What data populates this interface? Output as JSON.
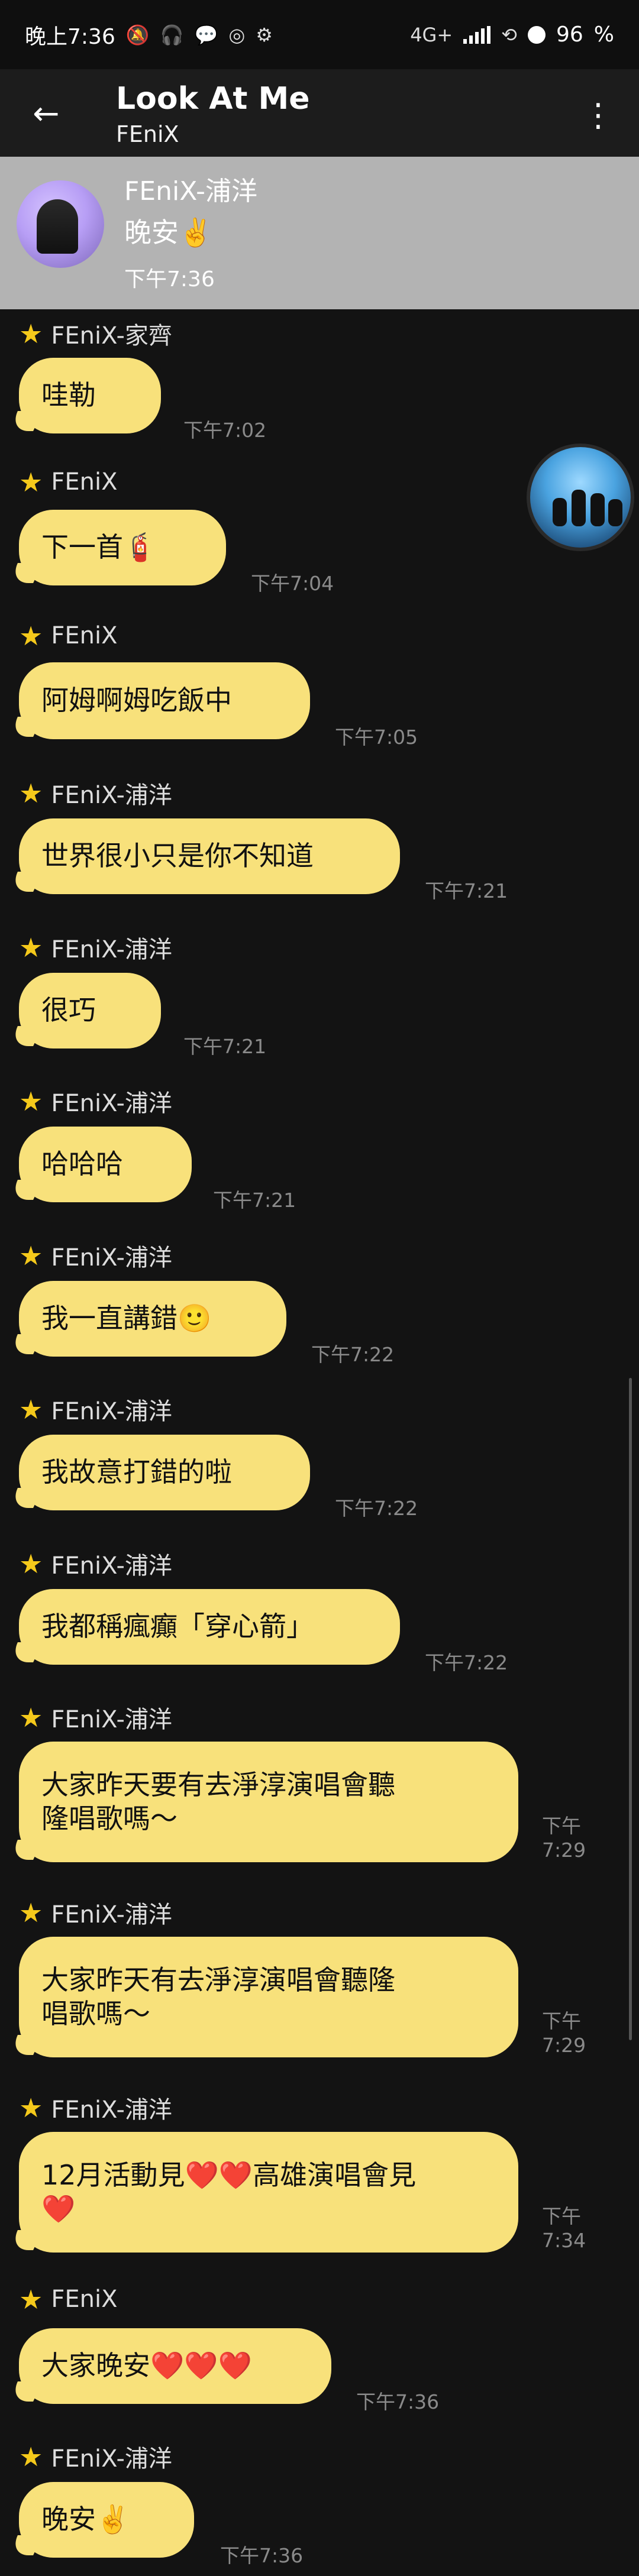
{
  "status_bar": {
    "time": "晚上7:36",
    "status_icons": [
      "muted-icon",
      "headphones-icon",
      "line-icon",
      "instagram-icon",
      "settings-icon"
    ],
    "network": "4G+",
    "battery": "96"
  },
  "header": {
    "title": "Look At Me",
    "subtitle": "FEniX",
    "back_icon": "←",
    "more_icon": "⋮"
  },
  "notice": {
    "sender": "FEniX-浦洋",
    "text": "晚安✌️",
    "time": "下午7:36"
  },
  "messages": [
    {
      "sender": "FEniX-家齊",
      "text": "哇勒",
      "time": "下午7:02"
    },
    {
      "sender": "FEniX",
      "text": "下一首🧯",
      "time": "下午7:04"
    },
    {
      "sender": "FEniX",
      "text": "阿姆啊姆吃飯中",
      "time": "下午7:05"
    },
    {
      "sender": "FEniX-浦洋",
      "text": "世界很小只是你不知道",
      "time": "下午7:21"
    },
    {
      "sender": "FEniX-浦洋",
      "text": "很巧",
      "time": "下午7:21"
    },
    {
      "sender": "FEniX-浦洋",
      "text": "哈哈哈",
      "time": "下午7:21"
    },
    {
      "sender": "FEniX-浦洋",
      "text": "我一直講錯🙂",
      "time": "下午7:22"
    },
    {
      "sender": "FEniX-浦洋",
      "text": "我故意打錯的啦",
      "time": "下午7:22"
    },
    {
      "sender": "FEniX-浦洋",
      "text": "我都稱瘋癲「穿心箭」",
      "time": "下午7:22"
    },
    {
      "sender": "FEniX-浦洋",
      "text_line1": "大家昨天要有去淨淳演唱會聽",
      "text_line2": "隆唱歌嗎～",
      "time_line1": "下午",
      "time_line2": "7:29"
    },
    {
      "sender": "FEniX-浦洋",
      "text_line1": "大家昨天有去淨淳演唱會聽隆",
      "text_line2": "唱歌嗎～",
      "time_line1": "下午",
      "time_line2": "7:29"
    },
    {
      "sender": "FEniX-浦洋",
      "text_line1": "12月活動見❤️❤️高雄演唱會見",
      "text_line2": "❤️",
      "time_line1": "下午",
      "time_line2": "7:34"
    },
    {
      "sender": "FEniX",
      "text": "大家晚安❤️❤️❤️",
      "time": "下午7:36"
    },
    {
      "sender": "FEniX-浦洋",
      "text": "晚安✌️",
      "time": "下午7:36"
    }
  ]
}
